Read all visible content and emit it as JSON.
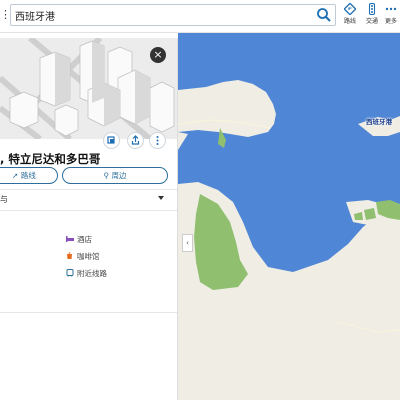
{
  "search": {
    "query": "西班牙港"
  },
  "toolbar": {
    "directions_label": "路线",
    "traffic_label": "交通",
    "more_label": "更多"
  },
  "place": {
    "title": ", 特立尼达和多巴哥",
    "directions_button": "路线",
    "nearby_button": "周边",
    "section_label": "与"
  },
  "nearby": [
    {
      "label": "酒店",
      "icon": "hotel-icon",
      "color": "#8a4fbf"
    },
    {
      "label": "咖啡馆",
      "icon": "coffee-icon",
      "color": "#e56b1f"
    },
    {
      "label": "附近线路",
      "icon": "transit-icon",
      "color": "#2b6f9a"
    }
  ],
  "map": {
    "place_label": "西班牙港",
    "water_color": "#4f86d6",
    "land_color": "#efede4",
    "park_color": "#8fbf6f"
  }
}
